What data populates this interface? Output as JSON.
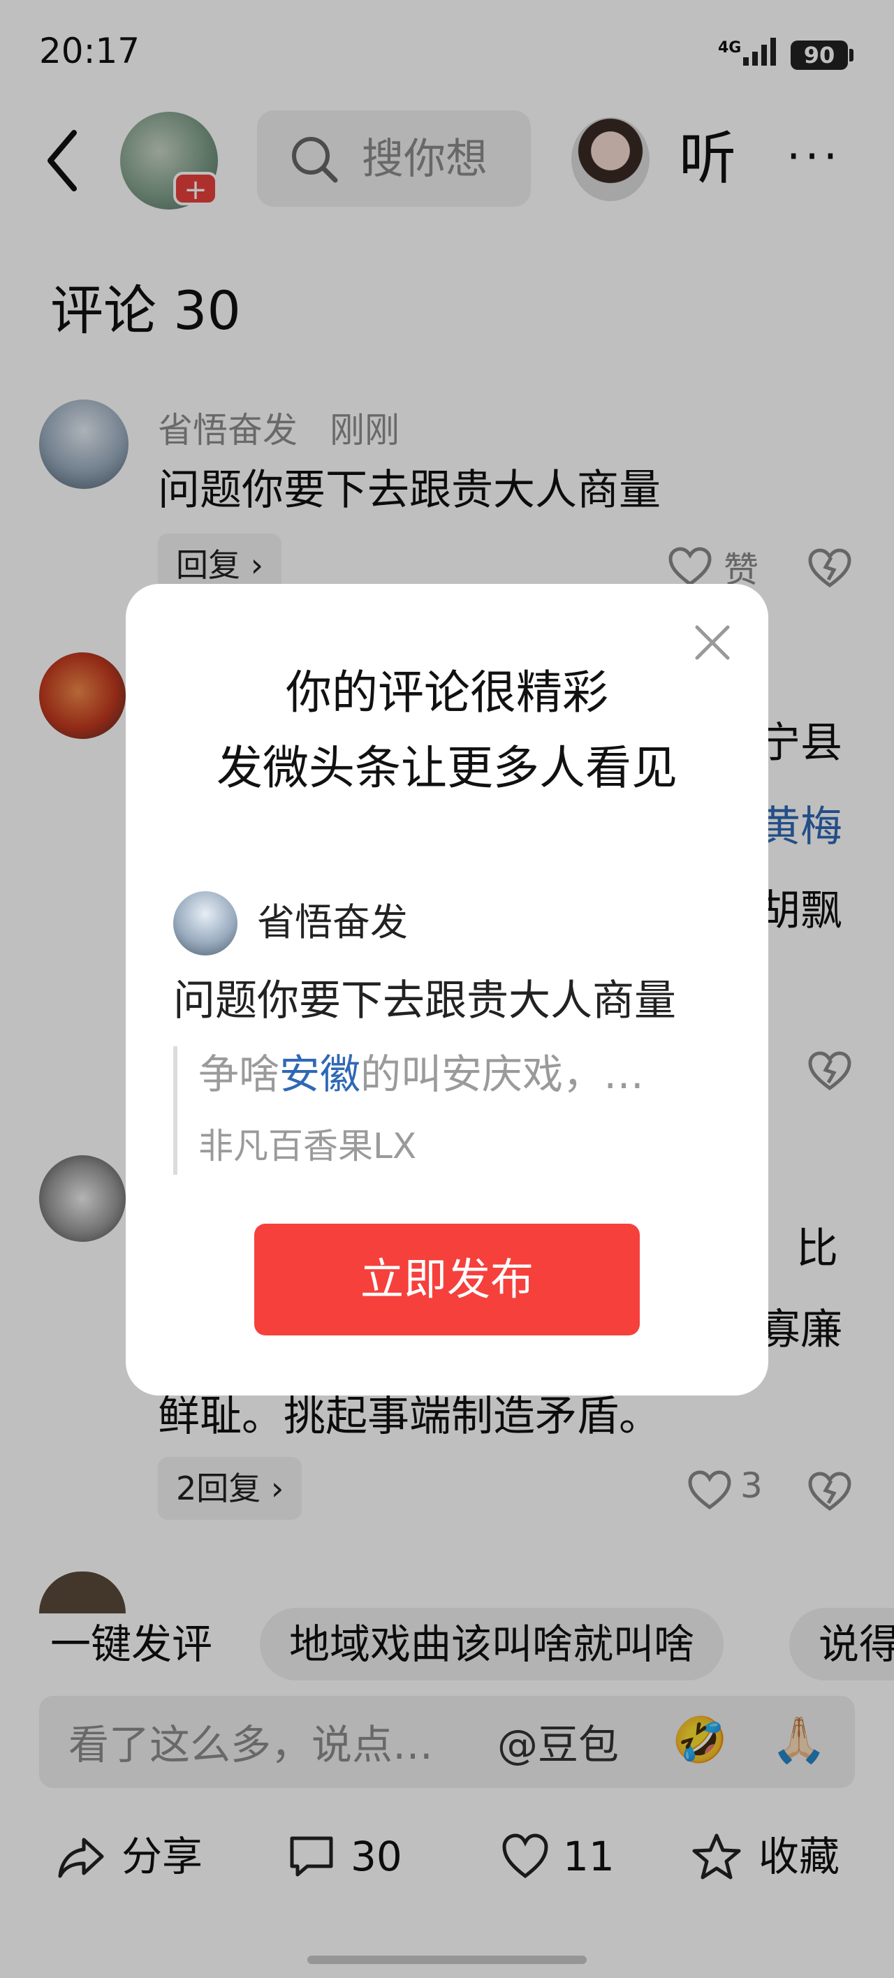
{
  "status_bar": {
    "time": "20:17",
    "network": "4G",
    "battery": "90"
  },
  "top_nav": {
    "search_placeholder": "搜你想",
    "listen_label": "听",
    "more_label": "···",
    "follow_badge": "+"
  },
  "comments_section": {
    "title": "评论 30",
    "comments": [
      {
        "name": "省悟奋发",
        "time": "刚刚",
        "text": "问题你要下去跟贵大人商量",
        "reply_label": "回复 ›",
        "like_label": "赞"
      },
      {
        "partial_lines": [
          "宁县",
          "黄梅",
          "胡飘"
        ]
      },
      {
        "partial_lines": [
          "比",
          "寡廉"
        ],
        "text_last": "鲜耻。挑起事端制造矛盾。",
        "reply_label": "2回复 ›",
        "like_count": "3"
      }
    ]
  },
  "quick_comment": {
    "label": "一键发评",
    "chips": [
      "地域戏曲该叫啥就叫啥",
      "说得"
    ]
  },
  "input": {
    "placeholder": "看了这么多，说点…",
    "mention": "@豆包",
    "emojis": [
      "🤣",
      "🙏🏻"
    ]
  },
  "actions": {
    "share": "分享",
    "comments": "30",
    "likes": "11",
    "favorite": "收藏"
  },
  "dialog": {
    "title_line1": "你的评论很精彩",
    "title_line2": "发微头条让更多人看见",
    "user_name": "省悟奋发",
    "comment_text": "问题你要下去跟贵大人商量",
    "quote_pre": "争啥",
    "quote_keyword": "安徽",
    "quote_post": "的叫安庆戏，…",
    "quote_author": "非凡百香果LX",
    "publish_label": "立即发布",
    "accent_color": "#f6403c"
  }
}
